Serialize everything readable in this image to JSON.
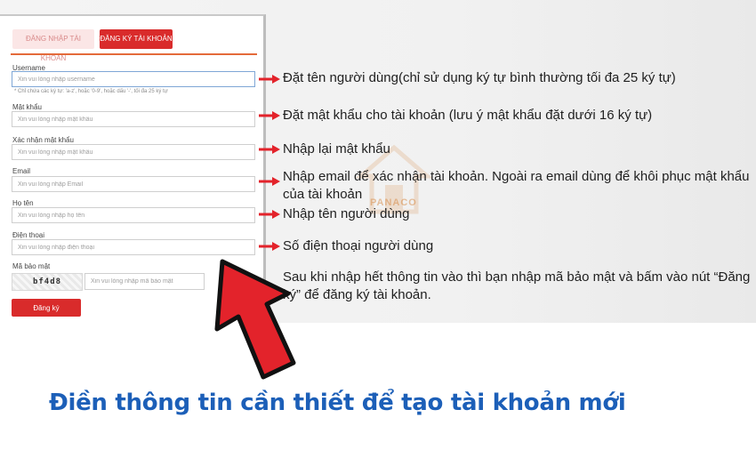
{
  "tabs": {
    "login": "ĐĂNG NHẬP TÀI KHOẢN",
    "register": "ĐĂNG KÝ TÀI KHOẢN"
  },
  "form": {
    "username": {
      "label": "Username",
      "placeholder": "Xin vui lòng nhập username",
      "hint": "* Chỉ chứa các ký tự: 'a-z', hoặc '0-9', hoặc dấu '-', tối đa 25 ký tự"
    },
    "password": {
      "label": "Mật khẩu",
      "placeholder": "Xin vui lòng nhập mật khẩu"
    },
    "confirm_password": {
      "label": "Xác nhận mật khẩu",
      "placeholder": "Xin vui lòng nhập mật khẩu"
    },
    "email": {
      "label": "Email",
      "placeholder": "Xin vui lòng nhập Email"
    },
    "full_name": {
      "label": "Họ tên",
      "placeholder": "Xin vui lòng nhập họ tên"
    },
    "phone": {
      "label": "Điện thoại",
      "placeholder": "Xin vui lòng nhập điện thoại"
    },
    "captcha": {
      "label": "Mã bảo mật",
      "code": "bf4d8",
      "placeholder": "Xin vui lòng nhập mã bảo mật"
    },
    "submit_label": "Đăng ký"
  },
  "annotations": {
    "username": "Đặt tên người dùng(chỉ sử dụng ký tự bình thường tối đa 25 ký tự)",
    "password": "Đặt mật khẩu cho tài khoản (lưu ý mật khẩu đặt dưới 16 ký tự)",
    "confirm": "Nhập lại mật khẩu",
    "email": "Nhập email để xác nhận tài khoản. Ngoài ra email dùng để khôi phục mật khẩu của tài khoản",
    "name": "Nhập tên người dùng",
    "phone": "Số điện thoại người dùng",
    "final": "Sau khi nhập hết thông tin vào thì bạn nhập mã bảo mật và bấm vào nút “Đăng ký” để đăng ký tài khoản."
  },
  "watermark": "PANACO",
  "headline": "Điền thông tin cần thiết để tạo tài khoản mới",
  "colors": {
    "accent_red": "#d92b2b",
    "headline_blue": "#1c5fb8",
    "arrow_red": "#e3232b"
  }
}
